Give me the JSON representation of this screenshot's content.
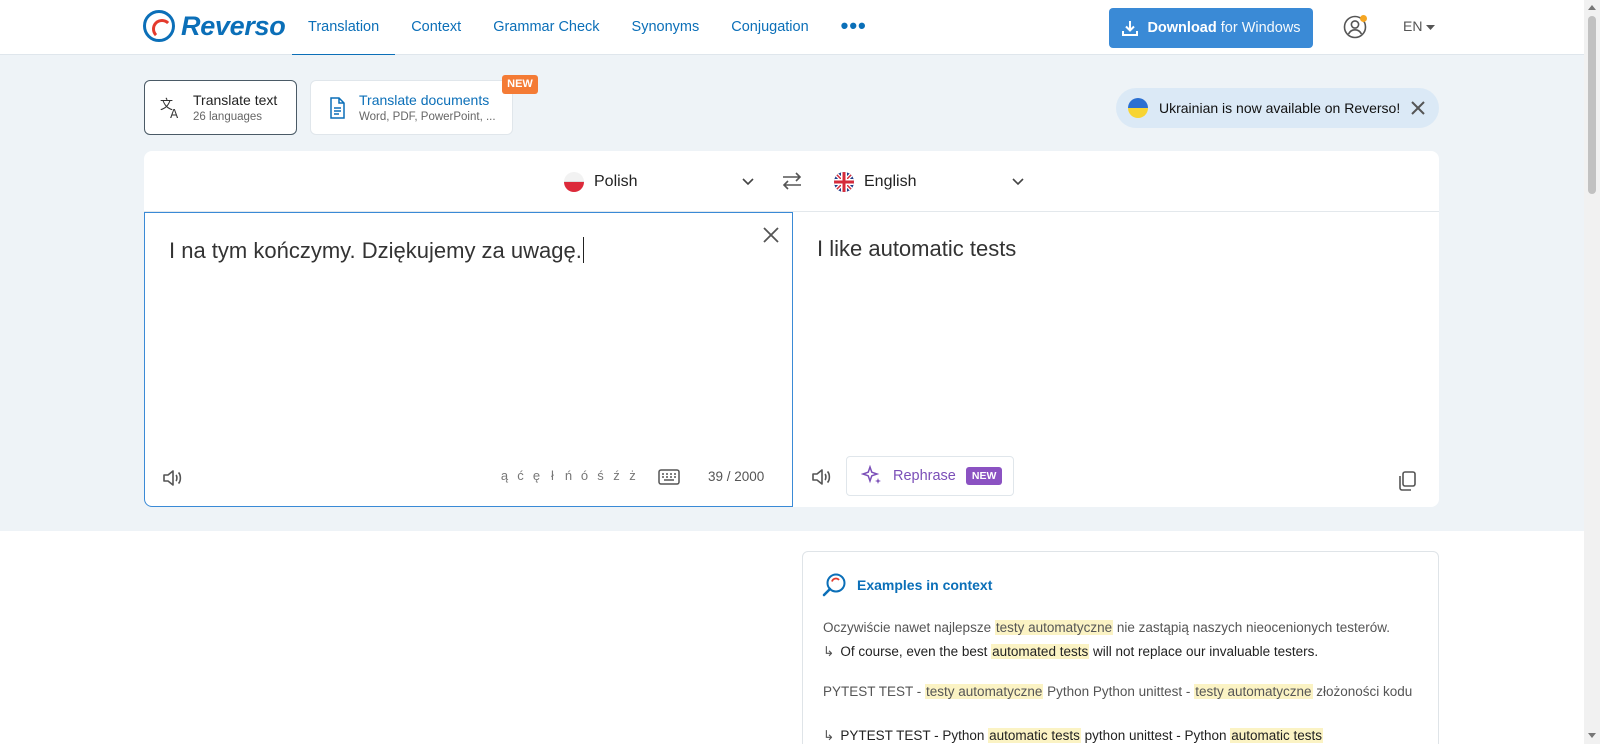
{
  "brand": {
    "name": "Reverso"
  },
  "nav": {
    "items": [
      "Translation",
      "Context",
      "Grammar Check",
      "Synonyms",
      "Conjugation"
    ],
    "more": "•••"
  },
  "download": {
    "bold": "Download",
    "rest": "for Windows"
  },
  "ui_lang": "EN",
  "modes": {
    "text": {
      "title": "Translate text",
      "sub": "26 languages"
    },
    "docs": {
      "title": "Translate documents",
      "sub": "Word, PDF, PowerPoint, ...",
      "badge": "NEW"
    }
  },
  "notice": {
    "text": "Ukrainian is now available on Reverso!"
  },
  "translator": {
    "source_lang": "Polish",
    "target_lang": "English",
    "source_text": "I na tym kończymy. Dziękujemy za uwagę.",
    "target_text": "I like automatic tests",
    "special_chars": [
      "ą",
      "ć",
      "ę",
      "ł",
      "ń",
      "ó",
      "ś",
      "ź",
      "ż"
    ],
    "char_count": "39 / 2000",
    "rephrase_label": "Rephrase",
    "rephrase_badge": "NEW"
  },
  "examples": {
    "title": "Examples in context",
    "items": [
      {
        "src_pre": "Oczywiście nawet najlepsze ",
        "src_hl": "testy automatyczne",
        "src_post": " nie zastąpią naszych nieocenionych testerów.",
        "tr_pre": "Of course, even the best ",
        "tr_hl": "automated tests",
        "tr_post": " will not replace our invaluable testers."
      },
      {
        "src_a": "PYTEST TEST - ",
        "src_hl1": "testy automatyczne",
        "src_b": " Python Python unittest - ",
        "src_hl2": "testy automatyczne",
        "src_c": " złożoności kodu",
        "tr_a": "PYTEST TEST - Python ",
        "tr_hl1": "automatic tests",
        "tr_b": " python unittest - Python ",
        "tr_hl2": "automatic tests"
      }
    ]
  },
  "colors": {
    "brand_blue": "#0b6fb8",
    "download_bg": "#3a8ad6",
    "badge_orange": "#f47b35",
    "rephrase_purple": "#8b52c2",
    "highlight": "#fbf3c4"
  }
}
